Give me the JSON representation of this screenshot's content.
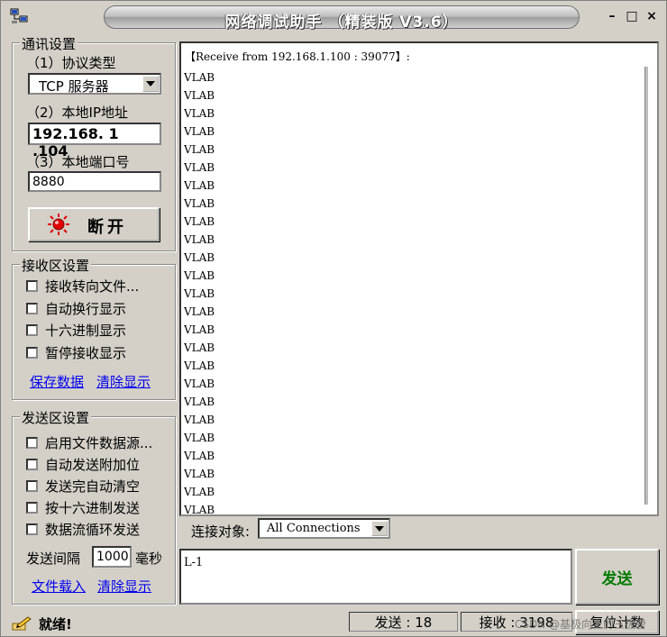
{
  "window": {
    "title": "网络调试助手 （精装版 V3.6）",
    "controls": [
      "–",
      "□",
      "×"
    ]
  },
  "comm_settings": {
    "group_title": "通讯设置",
    "protocol_label": "（1）协议类型",
    "protocol_value": "TCP 服务器",
    "ip_label": "（2）本地IP地址",
    "ip_value": "192.168. 1 .104",
    "port_label": "（3）本地端口号",
    "port_value": "8880",
    "disconnect_label": "断开",
    "status_color": "#e00000"
  },
  "receive_settings": {
    "group_title": "接收区设置",
    "options": [
      {
        "label": "接收转向文件...",
        "checked": false
      },
      {
        "label": "自动换行显示",
        "checked": false
      },
      {
        "label": "十六进制显示",
        "checked": false
      },
      {
        "label": "暂停接收显示",
        "checked": false
      }
    ],
    "save_link": "保存数据",
    "clear_link": "清除显示"
  },
  "send_settings": {
    "group_title": "发送区设置",
    "options": [
      {
        "label": "启用文件数据源...",
        "checked": false
      },
      {
        "label": "自动发送附加位",
        "checked": false
      },
      {
        "label": "发送完自动清空",
        "checked": false
      },
      {
        "label": "按十六进制发送",
        "checked": false
      },
      {
        "label": "数据流循环发送",
        "checked": false
      }
    ],
    "interval_label": "发送间隔",
    "interval_value": "1000",
    "interval_unit": "毫秒",
    "load_file_link": "文件载入",
    "clear_link": "清除显示"
  },
  "receive_area": {
    "header": "【Receive from 192.168.1.100 : 39077】:",
    "lines": [
      "VLAB",
      "VLAB",
      "VLAB",
      "VLAB",
      "VLAB",
      "VLAB",
      "VLAB",
      "VLAB",
      "VLAB",
      "VLAB",
      "VLAB",
      "VLAB",
      "VLAB",
      "VLAB",
      "VLAB",
      "VLAB",
      "VLAB",
      "VLAB",
      "VLAB",
      "VLAB",
      "VLAB",
      "VLAB",
      "VLAB",
      "VLAB",
      "VLAB"
    ]
  },
  "connection": {
    "label": "连接对象:",
    "value": "All Connections"
  },
  "send_area": {
    "text": "L-1",
    "send_button": "发送"
  },
  "status": {
    "ready": "就绪!",
    "sent_label": "发送 : 18",
    "recv_label": "接收 : 3198",
    "reset_label": "复位计数",
    "watermark": "CSDN @基极向上的三极管"
  }
}
